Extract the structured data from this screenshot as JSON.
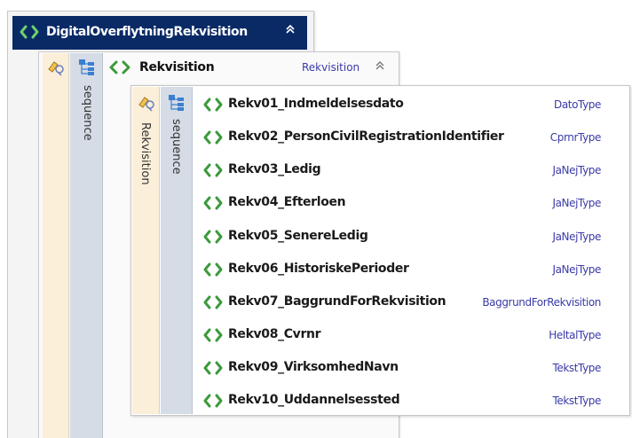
{
  "root": {
    "title": "DigitalOverflytningRekvisition",
    "collapse_glyph": "≈"
  },
  "level1": {
    "sequence_label": "sequence",
    "title": "Rekvisition",
    "type": "Rekvisition",
    "collapse_glyph": "≈"
  },
  "level2": {
    "element_label": "Rekvisition",
    "sequence_label": "sequence",
    "rows": [
      {
        "name": "Rekv01_Indmeldelsesdato",
        "type": "DatoType"
      },
      {
        "name": "Rekv02_PersonCivilRegistrationIdentifier",
        "type": "CprnrType"
      },
      {
        "name": "Rekv03_Ledig",
        "type": "JaNejType"
      },
      {
        "name": "Rekv04_Efterloen",
        "type": "JaNejType"
      },
      {
        "name": "Rekv05_SenereLedig",
        "type": "JaNejType"
      },
      {
        "name": "Rekv06_HistoriskePerioder",
        "type": "JaNejType"
      },
      {
        "name": "Rekv07_BaggrundForRekvisition",
        "type": "BaggrundForRekvisition"
      },
      {
        "name": "Rekv08_Cvrnr",
        "type": "HeltalType"
      },
      {
        "name": "Rekv09_VirksomhedNavn",
        "type": "TekstType"
      },
      {
        "name": "Rekv10_Uddannelsessted",
        "type": "TekstType"
      }
    ]
  },
  "colors": {
    "header_bg": "#0a2a66",
    "element_icon": "#3c9a3c",
    "type_text": "#3a3aa8"
  },
  "icons": {
    "element": "chevron-brackets-icon",
    "attributes": "attribute-pen-icon",
    "sequence": "sequence-tree-icon",
    "collapse": "double-chevron-up-icon"
  }
}
